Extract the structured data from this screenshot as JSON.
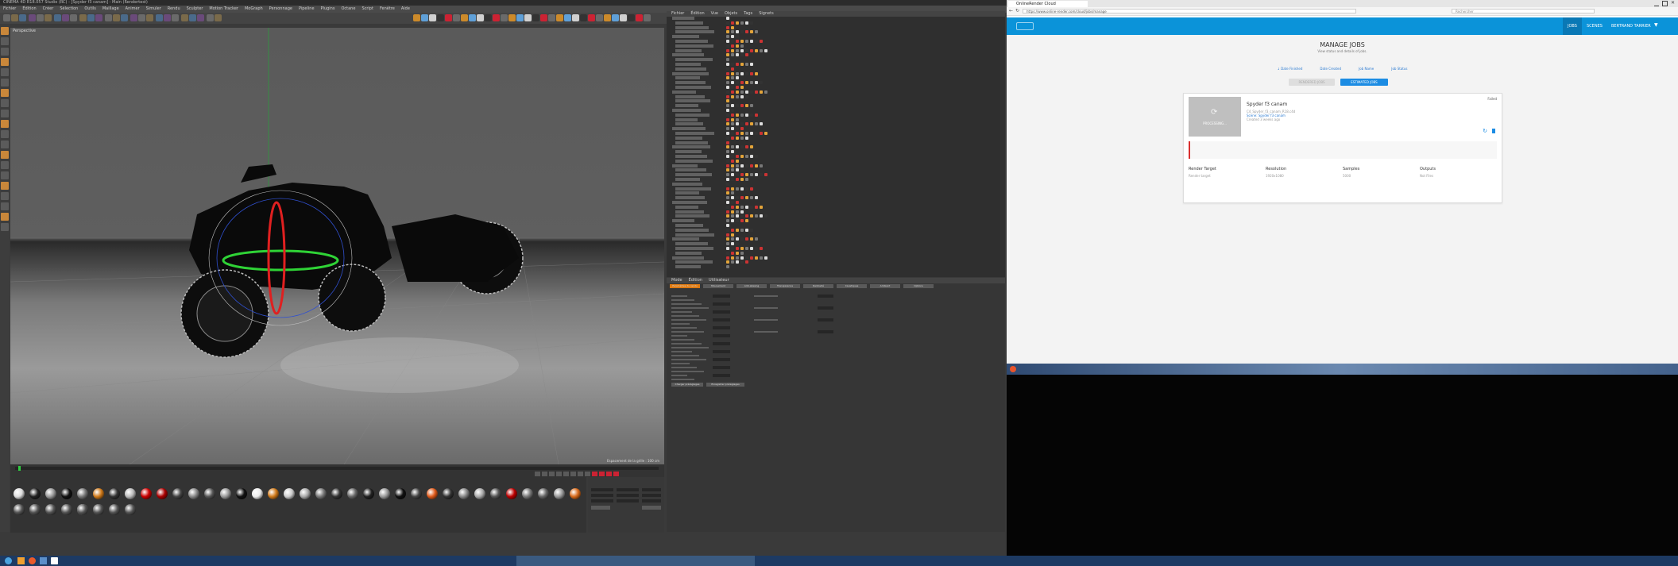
{
  "c4d": {
    "title": "CINEMA 4D R18.057 Studio (RC) - [Spyder f3 canam] - Main (Rendertest)",
    "menus": [
      "Fichier",
      "Édition",
      "Créer",
      "Sélection",
      "Outils",
      "Maillage",
      "Animer",
      "Simuler",
      "Rendu",
      "Sculpter",
      "Motion Tracker",
      "MoGraph",
      "Personnage",
      "Pipeline",
      "Plugins",
      "Octane",
      "Script",
      "Fenêtre",
      "Aide"
    ],
    "viewport_menu": [
      "Vue",
      "Caméras",
      "Affichage",
      "Options",
      "Filtres",
      "Panneaux"
    ],
    "viewport_label": "Perspective",
    "grid_label": "Espacement de la grille : 100 cm",
    "object_manager_menu": [
      "Fichier",
      "Édition",
      "Vue",
      "Objets",
      "Tags",
      "Signets"
    ],
    "attribute_manager_menu": [
      "Mode",
      "Édition",
      "Utilisateur"
    ],
    "attribute_tabs": [
      "Paramètres du rendu",
      "Mouvement",
      "Anti-aliasing",
      "Transparence",
      "Radiosité",
      "Caustiques",
      "Ambiant",
      "Options"
    ],
    "attr_buttons": [
      "Charger préréglages",
      "Enregistrer préréglages"
    ]
  },
  "browser": {
    "tab_title": "OnlineRender Cloud",
    "url": "https://www.online-render.com/cloud/jobs/manage",
    "search_placeholder": "Rechercher",
    "nav": {
      "jobs": "JOBS",
      "scenes": "SCENES",
      "user": "BERTRAND TARRIER"
    },
    "page_title": "MANAGE JOBS",
    "page_subtitle": "View status and details of jobs.",
    "filters": [
      "Date Finished",
      "Date Created",
      "Job Name",
      "Job Status"
    ],
    "rendered_jobs_label": "RENDERED JOBS",
    "estimated_jobs_label": "ESTIMATED JOBS",
    "job": {
      "status": "Failed",
      "name": "Spyder f3 canam",
      "file": "C4_Spyder_f3_canam_R18.c4d",
      "scene": "Scene: Spyder f3 canam",
      "created": "Created 3 weeks ago",
      "thumb_label": "PROCESSING...",
      "columns": [
        {
          "label": "Render Target",
          "value": "Render target"
        },
        {
          "label": "Resolution",
          "value": "1920x1080"
        },
        {
          "label": "Samples",
          "value": "5000"
        },
        {
          "label": "Outputs",
          "value": "Not Files"
        }
      ]
    }
  }
}
